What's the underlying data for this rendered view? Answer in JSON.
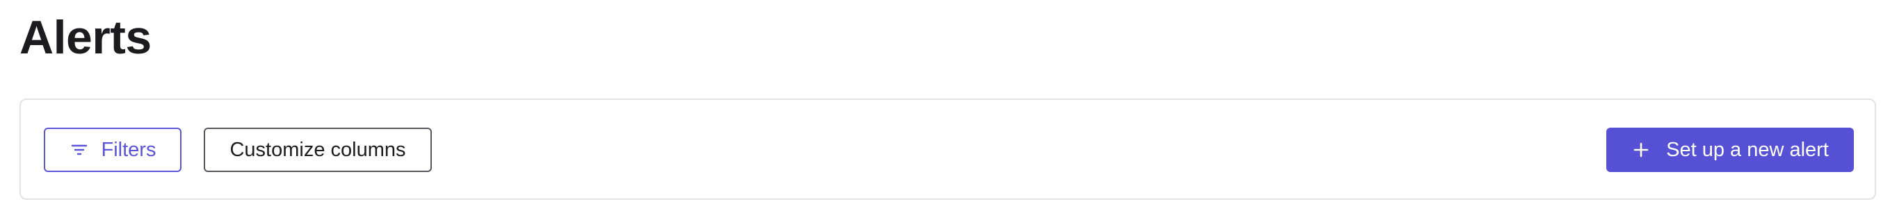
{
  "page": {
    "title": "Alerts"
  },
  "toolbar": {
    "filters_label": "Filters",
    "filters_icon": "filter-lines-icon",
    "customize_columns_label": "Customize columns",
    "new_alert_label": "Set up a new alert",
    "new_alert_icon": "plus-icon"
  },
  "colors": {
    "accent": "#5651d4",
    "border": "#e3e3e6",
    "text": "#1c1c1e"
  }
}
